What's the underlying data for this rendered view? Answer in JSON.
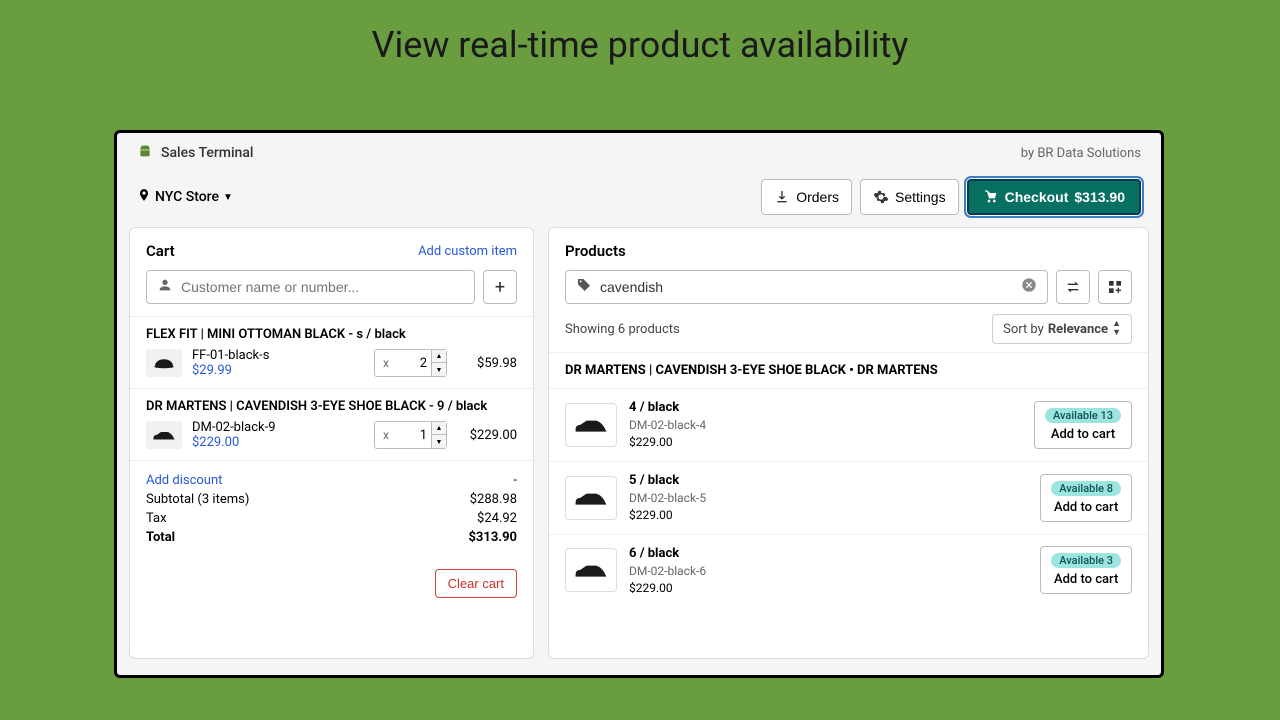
{
  "page_heading": "View real-time product availability",
  "header": {
    "app_title": "Sales Terminal",
    "byline": "by BR Data Solutions"
  },
  "topbar": {
    "store_name": "NYC Store",
    "orders_label": "Orders",
    "settings_label": "Settings",
    "checkout_label": "Checkout",
    "checkout_total": "$313.90"
  },
  "cart": {
    "title": "Cart",
    "add_custom_label": "Add custom item",
    "customer_placeholder": "Customer name or number...",
    "items": [
      {
        "title": "FLEX FIT | MINI OTTOMAN BLACK - s / black",
        "sku": "FF-01-black-s",
        "unit_price": "$29.99",
        "qty": "2",
        "line_total": "$59.98",
        "thumb": "cap"
      },
      {
        "title": "DR MARTENS | CAVENDISH 3-EYE SHOE BLACK - 9 / black",
        "sku": "DM-02-black-9",
        "unit_price": "$229.00",
        "qty": "1",
        "line_total": "$229.00",
        "thumb": "shoe"
      }
    ],
    "add_discount_label": "Add discount",
    "discount_value": "-",
    "subtotal_label": "Subtotal (3 items)",
    "subtotal_value": "$288.98",
    "tax_label": "Tax",
    "tax_value": "$24.92",
    "total_label": "Total",
    "total_value": "$313.90",
    "clear_label": "Clear cart"
  },
  "products": {
    "title": "Products",
    "search_value": "cavendish",
    "results_text": "Showing 6 products",
    "sort_prefix": "Sort by",
    "sort_value": "Relevance",
    "group_header": "DR MARTENS | CAVENDISH 3-EYE SHOE BLACK • DR MARTENS",
    "add_label": "Add to cart",
    "variants": [
      {
        "title": "4 / black",
        "sku": "DM-02-black-4",
        "price": "$229.00",
        "avail_label": "Available 13"
      },
      {
        "title": "5 / black",
        "sku": "DM-02-black-5",
        "price": "$229.00",
        "avail_label": "Available 8"
      },
      {
        "title": "6 / black",
        "sku": "DM-02-black-6",
        "price": "$229.00",
        "avail_label": "Available 3"
      }
    ]
  }
}
